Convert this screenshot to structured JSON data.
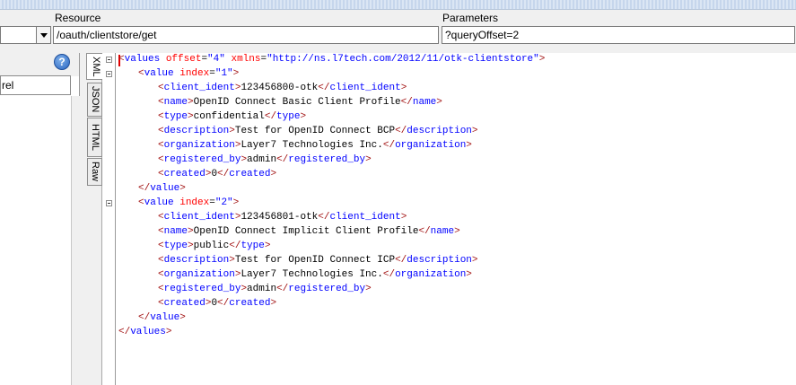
{
  "header": {
    "method_partial": "",
    "resource_label": "Resource",
    "resource_value": "/oauth/clientstore/get",
    "parameters_label": "Parameters",
    "parameters_value": "?queryOffset=2"
  },
  "left_panel": {
    "help_label": "?",
    "level_text": "rel"
  },
  "tabs": [
    {
      "label": "XML",
      "active": true
    },
    {
      "label": "JSON",
      "active": false
    },
    {
      "label": "HTML",
      "active": false
    },
    {
      "label": "Raw",
      "active": false
    }
  ],
  "xml": {
    "root_tag": "values",
    "root_attrs": [
      {
        "name": "offset",
        "value": "4"
      },
      {
        "name": "xmlns",
        "value": "http://ns.l7tech.com/2012/11/otk-clientstore"
      }
    ],
    "values": [
      {
        "index": "1",
        "fields": [
          {
            "tag": "client_ident",
            "text": "123456800-otk"
          },
          {
            "tag": "name",
            "text": "OpenID Connect Basic Client Profile"
          },
          {
            "tag": "type",
            "text": "confidential"
          },
          {
            "tag": "description",
            "text": "Test for OpenID Connect BCP"
          },
          {
            "tag": "organization",
            "text": "Layer7 Technologies Inc."
          },
          {
            "tag": "registered_by",
            "text": "admin"
          },
          {
            "tag": "created",
            "text": "0"
          }
        ]
      },
      {
        "index": "2",
        "fields": [
          {
            "tag": "client_ident",
            "text": "123456801-otk"
          },
          {
            "tag": "name",
            "text": "OpenID Connect Implicit Client Profile"
          },
          {
            "tag": "type",
            "text": "public"
          },
          {
            "tag": "description",
            "text": "Test for OpenID Connect ICP"
          },
          {
            "tag": "organization",
            "text": "Layer7 Technologies Inc."
          },
          {
            "tag": "registered_by",
            "text": "admin"
          },
          {
            "tag": "created",
            "text": "0"
          }
        ]
      }
    ]
  },
  "colors": {
    "tag": "#0000ff",
    "bracket": "#a31515",
    "attribute": "#ff0000",
    "attribute_value": "#0000ff",
    "text": "#000000"
  }
}
